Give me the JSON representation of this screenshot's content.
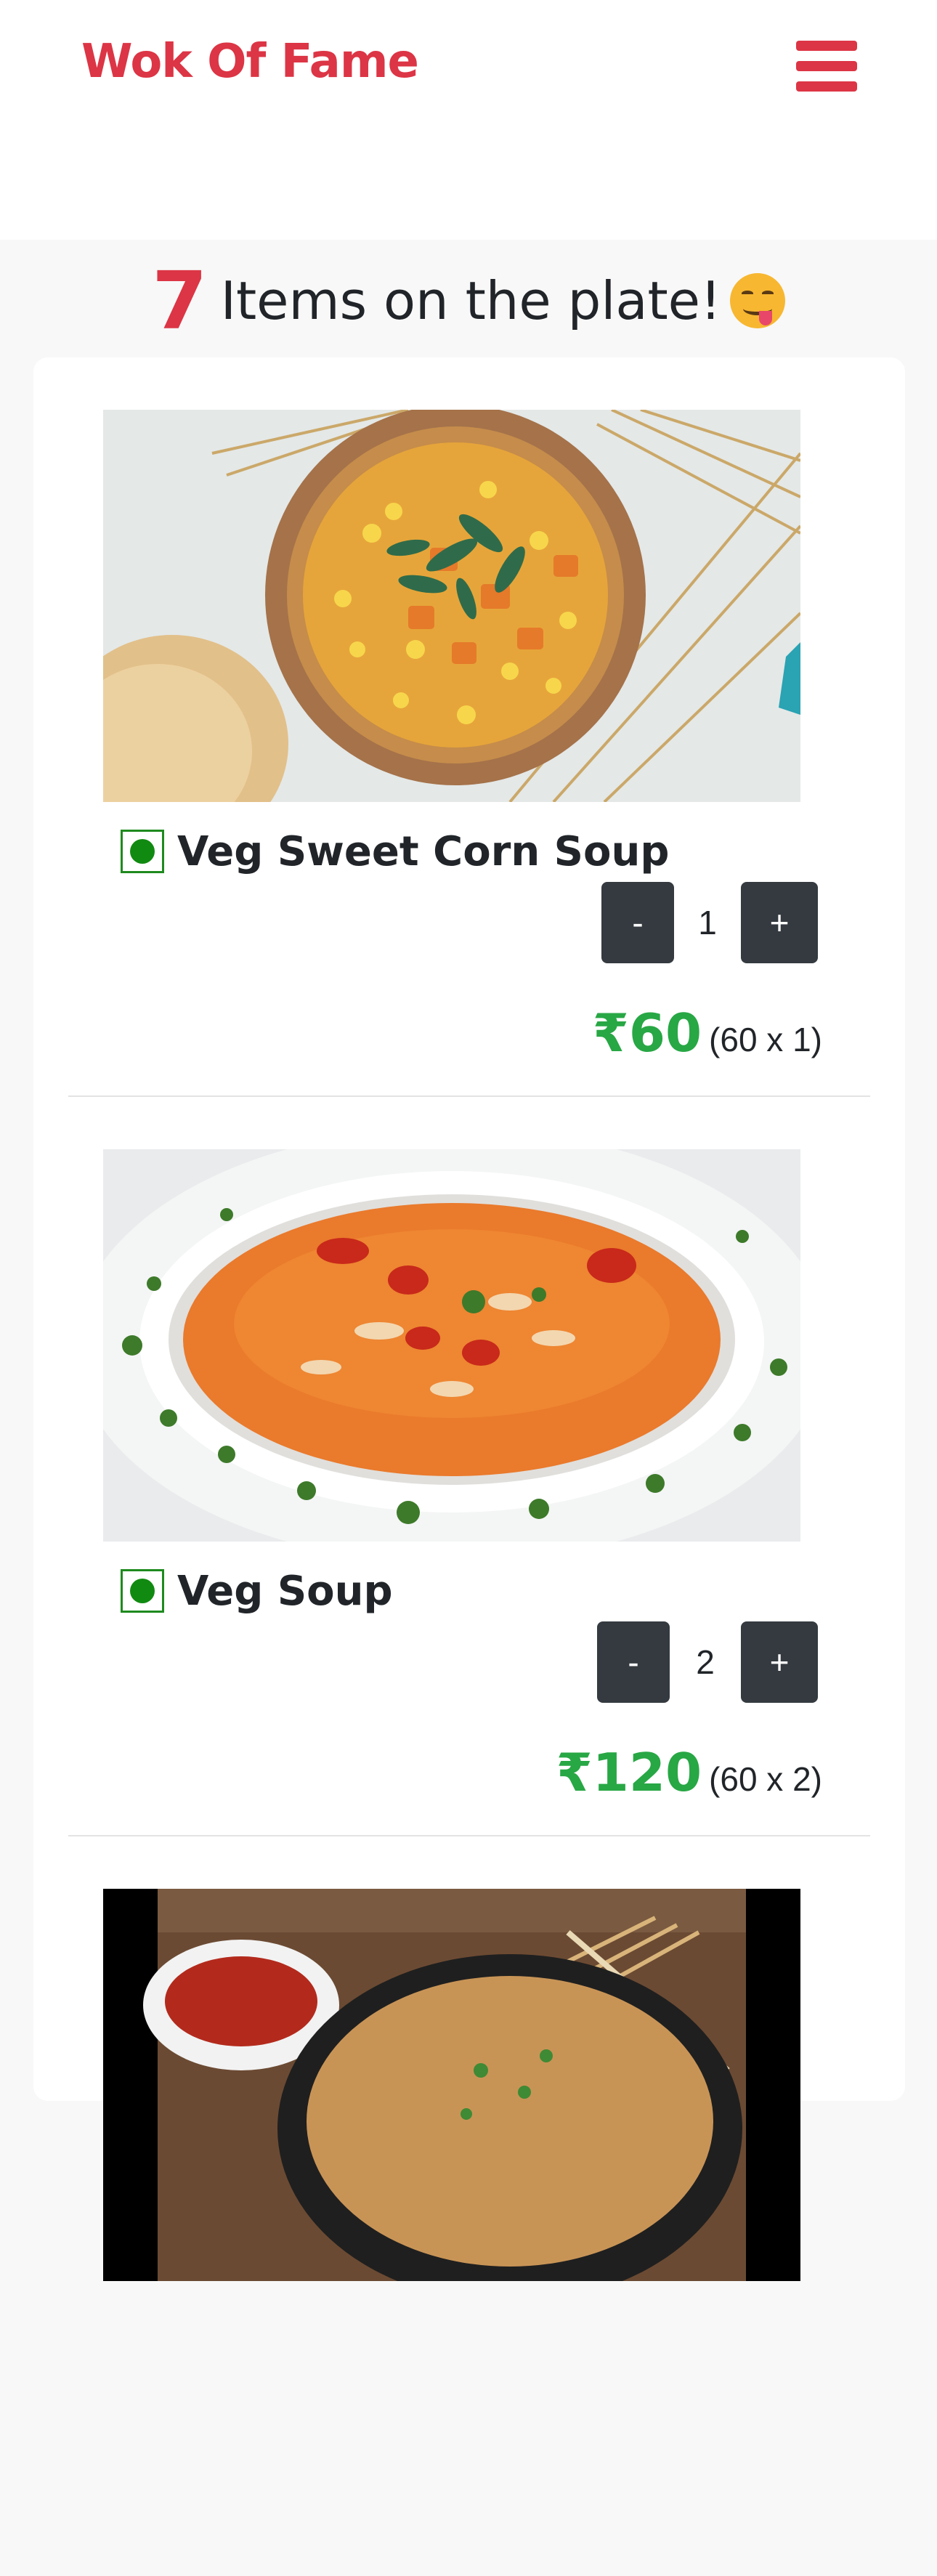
{
  "nav": {
    "brand": "Wok Of Fame",
    "menu_icon": "hamburger-menu-icon",
    "brand_color": "#dc3545"
  },
  "summary": {
    "count": "7",
    "text": "Items on the plate!",
    "emoji": "face-savoring-food"
  },
  "items": [
    {
      "name": "Veg Sweet Corn Soup",
      "veg": true,
      "qty_minus": "-",
      "qty": "1",
      "qty_plus": "+",
      "price": "₹60",
      "calc": "(60 x 1)"
    },
    {
      "name": "Veg Soup",
      "veg": true,
      "qty_minus": "-",
      "qty": "2",
      "qty_plus": "+",
      "price": "₹120",
      "calc": "(60 x 2)"
    }
  ],
  "colors": {
    "price_green": "#28a745",
    "button_dark": "#343a40",
    "veg_green": "#118a11"
  }
}
